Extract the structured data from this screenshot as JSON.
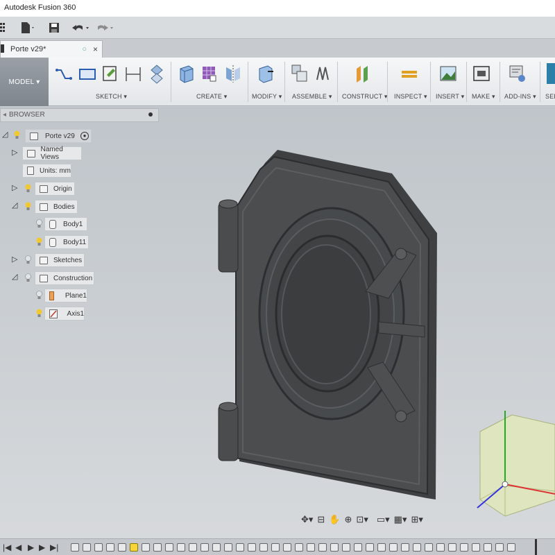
{
  "window": {
    "title": "Autodesk Fusion 360"
  },
  "quick_access": {
    "data_panel_icon": "grid-icon",
    "file_icon": "file-icon",
    "save_icon": "save-icon",
    "undo_icon": "undo-icon",
    "redo_icon": "redo-icon"
  },
  "document_tab": {
    "name": "Porte v29*",
    "status_icon": "circle-icon",
    "close_glyph": "×"
  },
  "ribbon": {
    "workspace": "MODEL ▾",
    "groups": [
      {
        "label": "SKETCH ▾"
      },
      {
        "label": "CREATE ▾"
      },
      {
        "label": "MODIFY ▾"
      },
      {
        "label": "ASSEMBLE ▾"
      },
      {
        "label": "CONSTRUCT ▾"
      },
      {
        "label": "INSPECT ▾"
      },
      {
        "label": "INSERT ▾"
      },
      {
        "label": "MAKE ▾"
      },
      {
        "label": "ADD-INS ▾"
      },
      {
        "label": "SEL"
      }
    ]
  },
  "browser": {
    "title": "BROWSER",
    "root": {
      "label": "Porte v29"
    },
    "named_views": {
      "label": "Named Views"
    },
    "units": {
      "label": "Units: mm"
    },
    "origin": {
      "label": "Origin"
    },
    "bodies": {
      "label": "Bodies",
      "items": [
        {
          "label": "Body1"
        },
        {
          "label": "Body11"
        }
      ]
    },
    "sketches": {
      "label": "Sketches"
    },
    "construction": {
      "label": "Construction",
      "items": [
        {
          "label": "Plane1"
        },
        {
          "label": "Axis1"
        }
      ]
    }
  },
  "viewport_nav": {
    "icons": [
      "orbit-icon",
      "look-at-icon",
      "pan-icon",
      "zoom-icon",
      "zoom-window-icon",
      "display-settings-icon",
      "grid-settings-icon",
      "viewports-icon"
    ]
  },
  "timeline": {
    "controls": [
      "first-icon",
      "previous-icon",
      "play-icon",
      "next-icon",
      "last-icon"
    ]
  },
  "colors": {
    "viewport": "#c9ced2",
    "model": "#4a4c4e",
    "view_cube": "#dfe6bf",
    "axis_x": "#d33",
    "axis_y": "#2a2",
    "axis_z": "#33d"
  }
}
